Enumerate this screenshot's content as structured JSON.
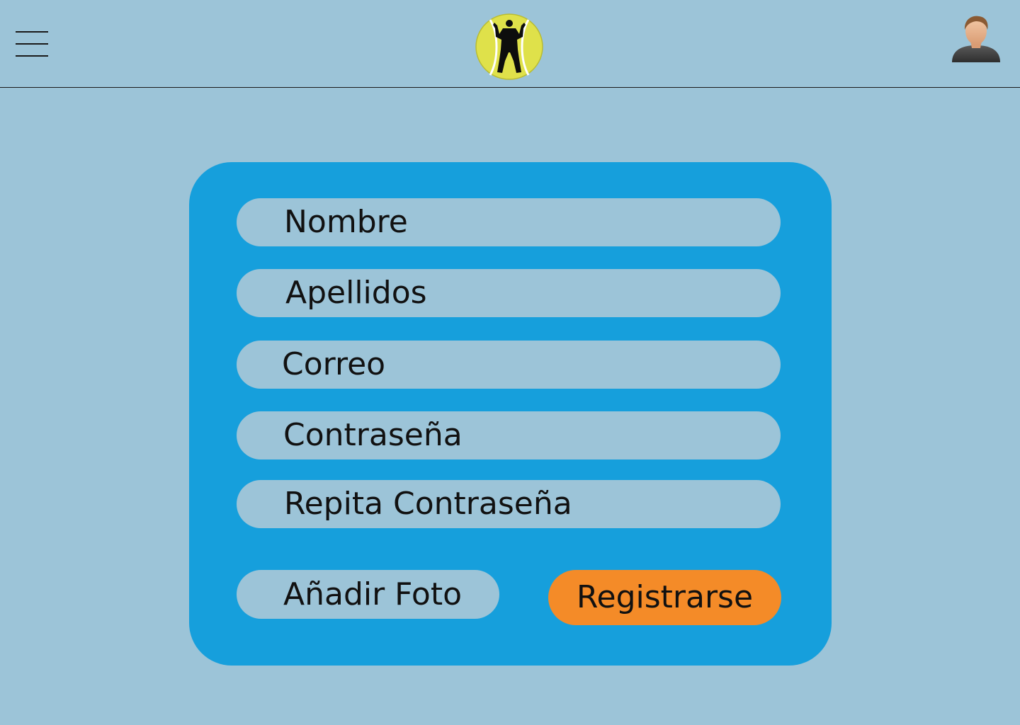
{
  "header": {
    "menu_icon": "hamburger-menu-icon",
    "logo_icon": "tennis-ball-bodybuilder-logo",
    "profile_icon": "user-avatar-icon"
  },
  "form": {
    "fields": [
      {
        "label": "Nombre"
      },
      {
        "label": "Apellidos"
      },
      {
        "label": "Correo"
      },
      {
        "label": "Contraseña"
      },
      {
        "label": "Repita Contraseña"
      }
    ],
    "add_photo_label": "Añadir Foto",
    "register_label": "Registrarse"
  },
  "colors": {
    "page_background": "#9cc4d8",
    "card_background": "#169fdc",
    "field_background": "#9cc4d8",
    "register_button": "#f48b28"
  }
}
